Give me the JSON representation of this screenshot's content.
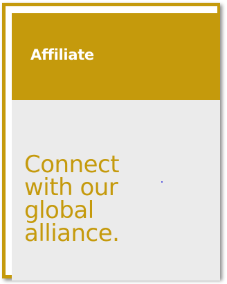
{
  "card": {
    "title": "Affiliate",
    "tagline": "Connect\nwith our\nglobal\nalliance.",
    "accent_color": "#c59a0c",
    "panel_color": "#ebebeb"
  }
}
